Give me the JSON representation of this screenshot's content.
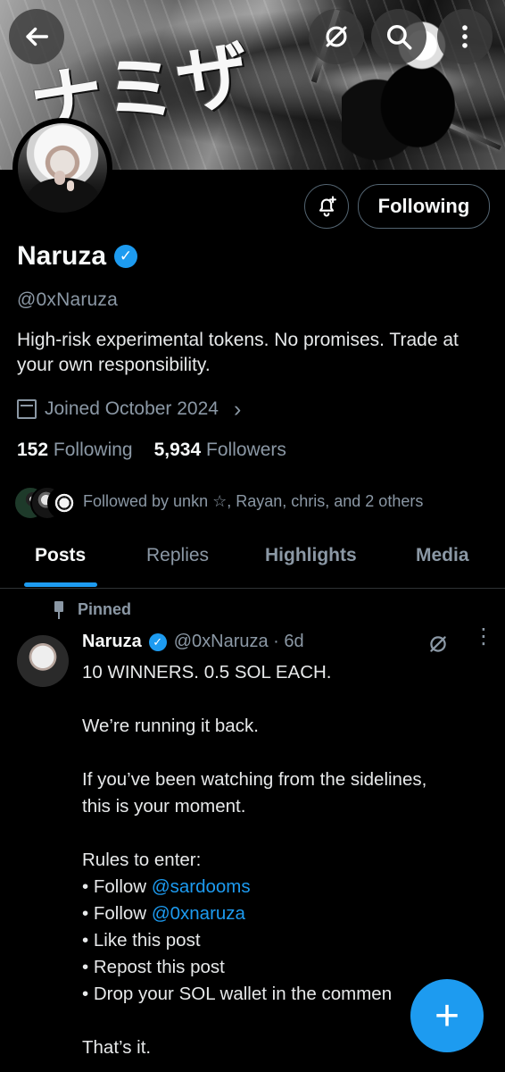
{
  "banner": {
    "calligraphy": "ナミザ"
  },
  "profile": {
    "name": "Naruza",
    "handle": "@0xNaruza",
    "bio": "High-risk experimental tokens. No promises. Trade at your own responsibility.",
    "joined": "Joined October 2024",
    "following_count": "152",
    "following_label": "Following",
    "followers_count": "5,934",
    "followers_label": "Followers",
    "followed_by": "Followed by unkn ☆, Rayan, chris, and 2 others",
    "follow_button": "Following"
  },
  "tabs": [
    {
      "label": "Posts"
    },
    {
      "label": "Replies"
    },
    {
      "label": "Highlights"
    },
    {
      "label": "Media"
    }
  ],
  "post": {
    "pinned_label": "Pinned",
    "author": "Naruza",
    "meta": "@0xNaruza · 6d",
    "lines": [
      "10 WINNERS. 0.5 SOL EACH.",
      "",
      "We’re running it back.",
      "",
      "If you’ve been watching from the sidelines,",
      "this is your moment.",
      "",
      "Rules to enter:",
      "• Follow ",
      "• Follow ",
      "• Like this post",
      "• Repost this post",
      "• Drop your SOL wallet in the commen",
      "",
      "That’s it."
    ],
    "links": [
      "@sardooms",
      "@0xnaruza"
    ]
  },
  "fab": {
    "label": "+"
  },
  "colors": {
    "background": "#000000",
    "text": "#e7e9ea",
    "muted": "#8b98a5",
    "accent": "#1d9bf0"
  },
  "icons": [
    "back-arrow-icon",
    "grok-icon",
    "search-icon",
    "more-vertical-icon",
    "notification-bell-plus-icon",
    "verified-badge-icon",
    "calendar-icon",
    "chevron-right-icon",
    "pin-icon",
    "plus-icon"
  ]
}
